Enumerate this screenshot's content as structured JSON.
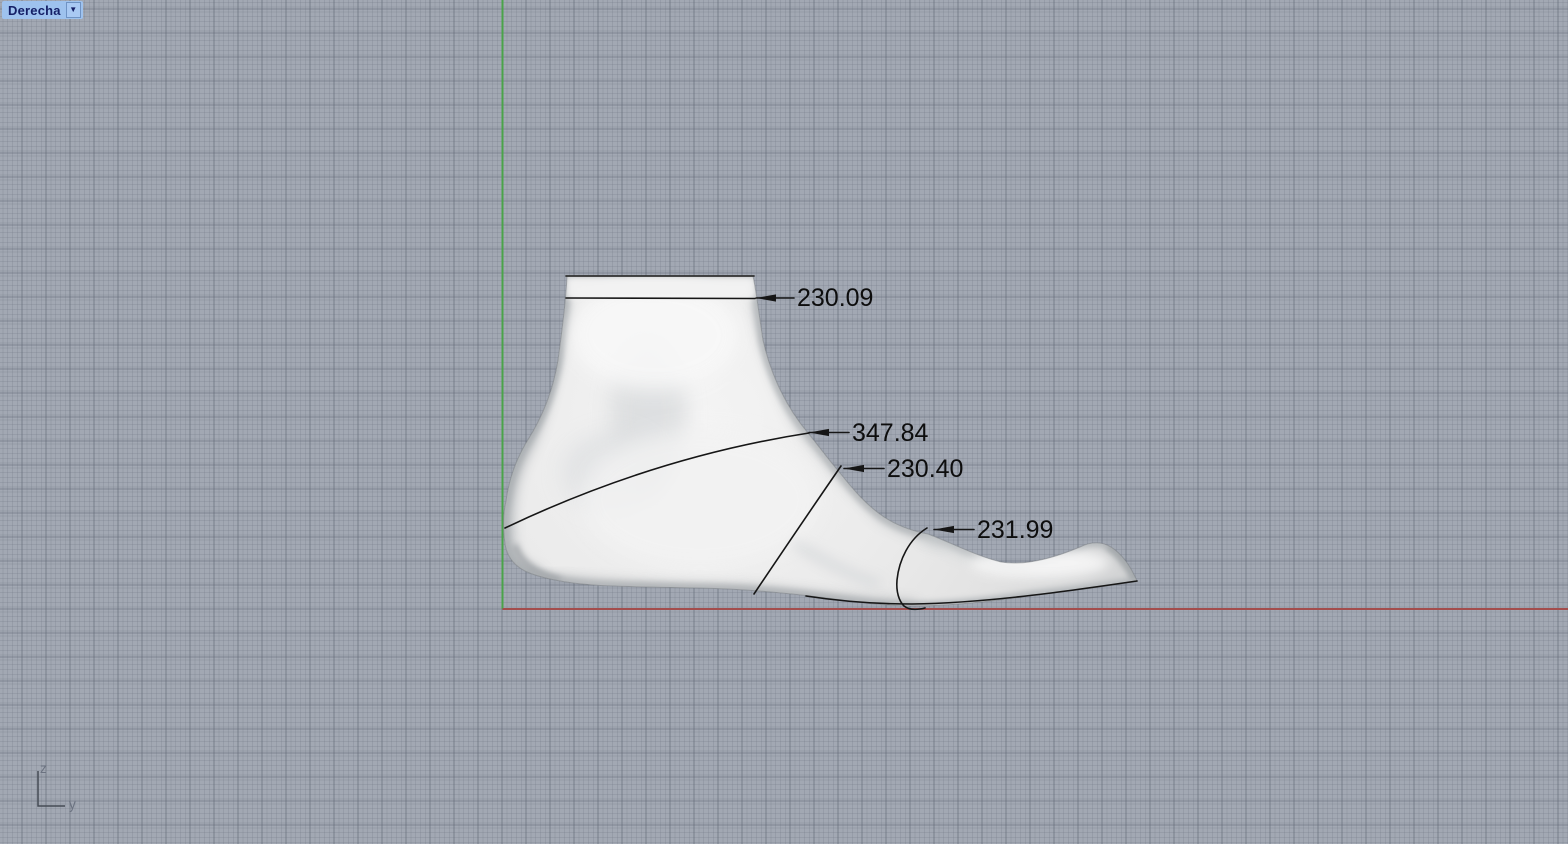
{
  "viewport": {
    "label": "Derecha",
    "caret_icon": "▼"
  },
  "dimensions": {
    "cuff_top": "230.09",
    "instep_girth": "347.84",
    "waist_girth": "230.40",
    "ball_girth": "231.99"
  },
  "axis_gizmo": {
    "z_label": "z",
    "y_label": "y"
  },
  "colors": {
    "vertical_axis_green": "#4aa34a",
    "horizontal_axis_red": "#a34d4d",
    "background": "#a2a8b3",
    "grid_major_line": "#61677a",
    "viewport_tab_bg": "#9ec2ee",
    "viewport_tab_text": "#141f66",
    "dimension_text": "#0d0d0d",
    "model_base": "#ebebeb"
  }
}
